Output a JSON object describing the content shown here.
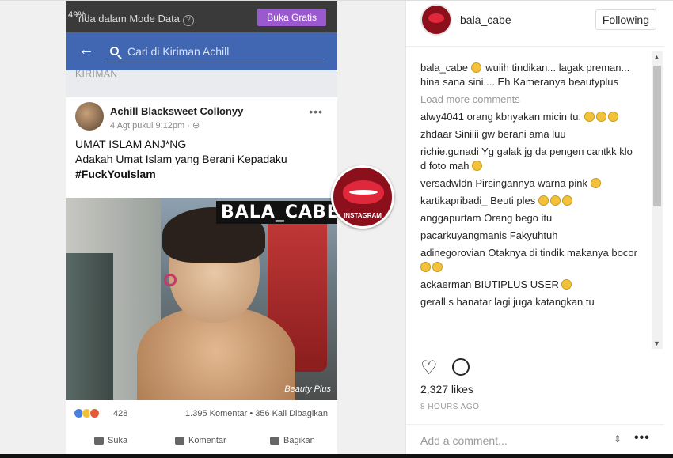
{
  "left": {
    "status": {
      "battery": "49%",
      "mode": "nda dalam Mode Data",
      "help": "?",
      "free_button": "Buka Gratis"
    },
    "search": {
      "placeholder": "Cari di Kiriman Achill"
    },
    "section_label": "KIRIMAN",
    "post": {
      "author": "Achill Blacksweet Collonyy",
      "time": "4 Agt pukul 9:12pm · ⊕",
      "more": "•••",
      "line1": "UMAT ISLAM ANJ*NG",
      "line2": "Adakah Umat Islam yang Berani Kepadaku",
      "hashtag": "#FuckYouIslam",
      "watermark": "BALA_CABE",
      "beauty_tag": "Beauty Plus",
      "badge_label": "INSTAGRAM",
      "reaction_count": "428",
      "stats": "1.395 Komentar • 356 Kali Dibagikan",
      "actions": [
        "Suka",
        "Komentar",
        "Bagikan"
      ]
    }
  },
  "panel": {
    "username": "bala_cabe",
    "follow_label": "Following",
    "caption_user": "bala_cabe",
    "caption_text": "wuiih tindikan... lagak preman... hina sana sini.... Eh Kameranya beautyplus",
    "load_more": "Load more comments",
    "comments": [
      {
        "user": "alwy4041",
        "text": "orang kbnyakan micin tu.",
        "emojis": 3
      },
      {
        "user": "zhdaar",
        "text": "Siniiii gw berani ama luu",
        "emojis": 0
      },
      {
        "user": "richie.gunadi",
        "text": "Yg galak jg da pengen cantkk klo d foto mah",
        "emojis": 1
      },
      {
        "user": "versadwldn",
        "text": "Pirsingannya warna pink",
        "emojis": 1
      },
      {
        "user": "kartikapribadi_",
        "text": "Beuti ples",
        "emojis": 3
      },
      {
        "user": "anggapurtam",
        "text": "Orang bego itu",
        "emojis": 0
      },
      {
        "user": "pacarkuyangmanis",
        "text": "Fakyuhtuh",
        "emojis": 0
      },
      {
        "user": "adinegorovian",
        "text": "Otaknya di tindik makanya bocor",
        "emojis": 2
      },
      {
        "user": "ackaerman",
        "text": "BIUTIPLUS USER",
        "emojis": 1
      },
      {
        "user": "gerall.s",
        "text": "hanatar lagi juga katangkan tu",
        "emojis": 0
      }
    ],
    "likes": "2,327 likes",
    "ago": "8 HOURS AGO",
    "comment_placeholder": "Add a comment..."
  }
}
